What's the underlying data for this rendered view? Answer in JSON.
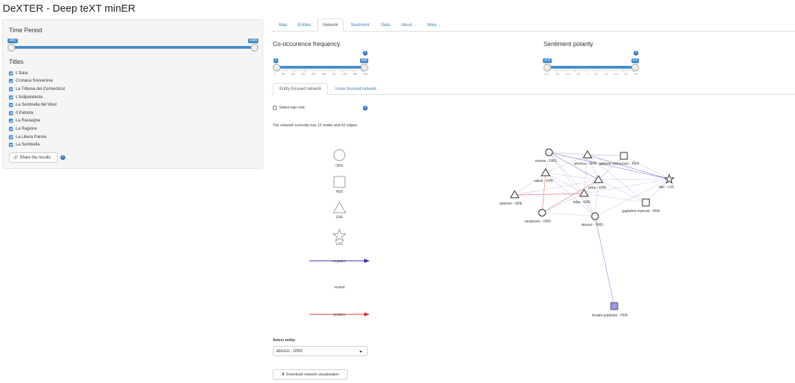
{
  "app": {
    "title": "DeXTER - Deep teXT minER"
  },
  "sidebar": {
    "time_period_label": "Time Period",
    "time_slider": {
      "min_label": "1907",
      "max_label": "1936",
      "selected_from": 1907,
      "selected_to": 1936
    },
    "titles_label": "Titles",
    "titles": [
      {
        "label": "L'Italia",
        "checked": true
      },
      {
        "label": "Cronaca Sovversiva",
        "checked": true
      },
      {
        "label": "La Tribuna del Connecticut",
        "checked": true
      },
      {
        "label": "L'Indipendente",
        "checked": true
      },
      {
        "label": "La Sentinella del West",
        "checked": true
      },
      {
        "label": "Il Patriota",
        "checked": true
      },
      {
        "label": "La Rassegna",
        "checked": true
      },
      {
        "label": "La Ragione",
        "checked": true
      },
      {
        "label": "La Libera Parola",
        "checked": true
      },
      {
        "label": "La Sentinella",
        "checked": true
      }
    ],
    "share_button": "Share the results"
  },
  "tabs": [
    "Map",
    "Entities",
    "Network",
    "Sentiment",
    "Data",
    "About ...",
    "More ..."
  ],
  "active_tab": "Network",
  "cooccurrence": {
    "title": "Co-occurence frequency",
    "from_label": "1",
    "to_label": "520",
    "ticks": [
      "1",
      "58",
      "116",
      "174",
      "232",
      "289",
      "347",
      "405",
      "462",
      "520"
    ]
  },
  "sentiment": {
    "title": "Sentiment polarity",
    "from_label": "-0.4",
    "to_label": "0.5",
    "ticks": [
      "-0.4",
      "-0.3",
      "-0.2",
      "-0.1",
      "0",
      "0.1",
      "0.2",
      "0.3",
      "0.4",
      "0.5"
    ]
  },
  "subtabs": [
    "Entity-focused network",
    "Issue-focused network"
  ],
  "active_subtab": "Entity-focused network",
  "ego_only_label": "Select ego only",
  "network_status": "The network currently has 12 nodes and 42 edges.",
  "legend": {
    "shapes": [
      {
        "label": "ORG",
        "icon": "circle"
      },
      {
        "label": "PER",
        "icon": "square"
      },
      {
        "label": "GPE",
        "icon": "triangle"
      },
      {
        "label": "LOC",
        "icon": "star"
      }
    ],
    "edges": [
      {
        "label": "negative",
        "color": "#2b2bb8"
      },
      {
        "label": "neutral",
        "color": "#ffffff"
      },
      {
        "label": "positive",
        "color": "#e03030"
      }
    ]
  },
  "network": {
    "nodes": [
      {
        "label": "marina - ORG",
        "shape": "circle"
      },
      {
        "label": "america - GPE",
        "shape": "triangle"
      },
      {
        "label": "gabriele d'annunzio - PER",
        "shape": "square"
      },
      {
        "label": "napoli - GPE",
        "shape": "triangle"
      },
      {
        "label": "roma - GPE",
        "shape": "triangle"
      },
      {
        "label": "alpi - LOC",
        "shape": "star"
      },
      {
        "label": "italia - GPE",
        "shape": "triangle"
      },
      {
        "label": "palermo - GPE",
        "shape": "triangle"
      },
      {
        "label": "guglielmo marconi - PER",
        "shape": "square"
      },
      {
        "label": "congresso - ORG",
        "shape": "circle"
      },
      {
        "label": "abruzzi - ORG",
        "shape": "circle"
      },
      {
        "label": "frontini publisher - PER",
        "shape": "square",
        "highlighted": true
      }
    ],
    "edge_count": 42
  },
  "select_entity": {
    "label": "Select entity",
    "value": "abruzzi - ORG"
  },
  "download_button": "Download network visualization",
  "colors": {
    "accent": "#428bca",
    "link": "#337ab7",
    "info": "#3a78b8",
    "highlight_node": "#9c9ce8"
  }
}
